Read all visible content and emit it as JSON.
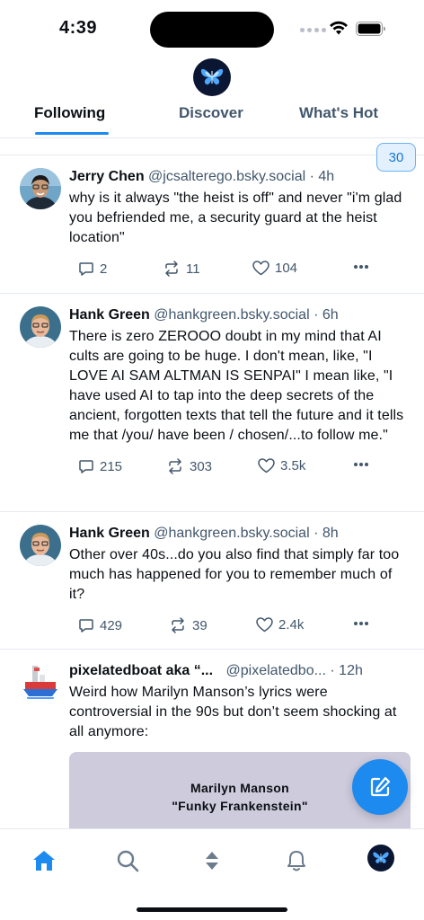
{
  "status": {
    "time": "4:39"
  },
  "header": {
    "logo": "butterfly-logo",
    "tabs": [
      {
        "label": "Following",
        "active": true
      },
      {
        "label": "Discover",
        "active": false
      },
      {
        "label": "What's Hot",
        "active": false
      }
    ]
  },
  "new_posts_count": "30",
  "posts": [
    {
      "author": "Jerry Chen",
      "handle": "@jcsalterego.bsky.social",
      "sep": "·",
      "time": "4h",
      "text": "why is it always \"the heist is off\" and never \"i'm glad you befriended me, a security guard at the heist location\"",
      "replies": "2",
      "reposts": "11",
      "likes": "104"
    },
    {
      "author": "Hank Green",
      "handle": "@hankgreen.bsky.social",
      "sep": "·",
      "time": "6h",
      "text": "There is zero ZEROOO doubt in my mind that AI cults are going to be huge. I don't mean, like, \"I LOVE AI SAM ALTMAN IS SENPAI\" I mean like, \"I have used AI to tap into the deep secrets of the ancient, forgotten texts that tell the future and it tells me that /you/ have been / chosen/...to follow me.\"",
      "replies": "215",
      "reposts": "303",
      "likes": "3.5k"
    },
    {
      "author": "Hank Green",
      "handle": "@hankgreen.bsky.social",
      "sep": "·",
      "time": "8h",
      "text": "Other over 40s...do you also find that simply far too much has happened for you to remember much of it?",
      "replies": "429",
      "reposts": "39",
      "likes": "2.4k"
    },
    {
      "author": "pixelatedboat aka “...",
      "handle": "@pixelatedbo...",
      "sep": "·",
      "time": "12h",
      "text": "Weird how Marilyn Manson’s lyrics were controversial in the 90s but don’t seem shocking at all anymore:",
      "embed_line1": "Marilyn Manson",
      "embed_line2": "\"Funky Frankenstein\""
    }
  ],
  "colors": {
    "accent": "#1d8af0",
    "muted_text": "#42576c",
    "divider": "#e6e9ee",
    "embed_bg": "#cdcbdc"
  },
  "bottom_nav": [
    "home-icon",
    "search-icon",
    "feeds-icon",
    "bell-icon",
    "profile-avatar"
  ]
}
